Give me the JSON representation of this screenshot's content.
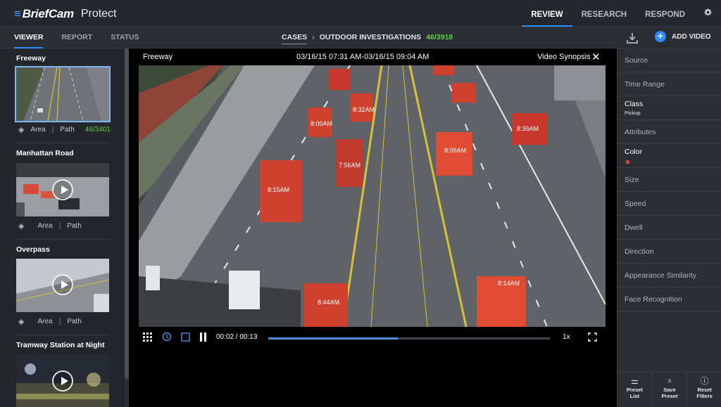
{
  "brand": {
    "logo": "BriefCam",
    "app": "Protect"
  },
  "topnav": {
    "tabs": [
      "REVIEW",
      "RESEARCH",
      "RESPOND"
    ],
    "active": "REVIEW",
    "settings_icon": "gear-icon"
  },
  "subnav": {
    "tabs": [
      "VIEWER",
      "REPORT",
      "STATUS"
    ],
    "active": "VIEWER",
    "breadcrumb": {
      "root": "CASES",
      "separator": "›",
      "current": "OUTDOOR INVESTIGATIONS",
      "count": "46/3918"
    },
    "download_icon": "download-icon",
    "add_video": "ADD VIDEO"
  },
  "cameras": [
    {
      "name": "Freeway",
      "area": "Area",
      "path": "Path",
      "count": "46/3401",
      "selected": true
    },
    {
      "name": "Manhattan Road",
      "area": "Area",
      "path": "Path",
      "count": ""
    },
    {
      "name": "Overpass",
      "area": "Area",
      "path": "Path",
      "count": ""
    },
    {
      "name": "Tramway Station at Night",
      "area": "",
      "path": "",
      "count": ""
    }
  ],
  "viewer": {
    "camera": "Freeway",
    "range": "03/16/15 07:31 AM-03/16/15 09:04 AM",
    "mode": "Video Synopsis",
    "close": "✕",
    "time": "00:02 / 00:13",
    "speed": "1x",
    "progress": 0.46,
    "buffered_end": 0.44,
    "timestamps": [
      "8:36AM",
      "8:09AM",
      "7:56AM",
      "8:15AM",
      "8:44AM",
      "8:14AM",
      "8:00AM",
      "8:32AM"
    ]
  },
  "filters": [
    {
      "label": "Source"
    },
    {
      "label": "Time Range"
    },
    {
      "label": "Class",
      "value": "Pickup"
    },
    {
      "label": "Attributes"
    },
    {
      "label": "Color",
      "swatch": "#e03b2c"
    },
    {
      "label": "Size"
    },
    {
      "label": "Speed"
    },
    {
      "label": "Dwell"
    },
    {
      "label": "Direction"
    },
    {
      "label": "Appearance Similarity"
    },
    {
      "label": "Face Recognition"
    }
  ],
  "bottom_buttons": [
    {
      "label1": "Preset",
      "label2": "List"
    },
    {
      "label1": "Save",
      "label2": "Preset"
    },
    {
      "label1": "Reset",
      "label2": "Filters"
    }
  ],
  "colors": {
    "accent": "#2d8cff",
    "count_green": "#62c94a",
    "truck_red": "#e03b2c"
  }
}
